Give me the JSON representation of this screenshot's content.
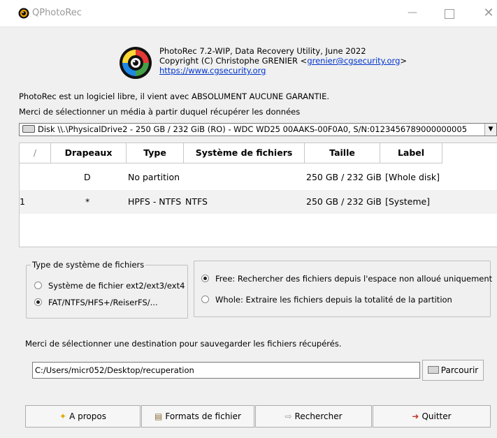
{
  "window": {
    "title": "QPhotoRec"
  },
  "about": {
    "line1": "PhotoRec 7.2-WIP, Data Recovery Utility, June 2022",
    "line2_prefix": "Copyright (C) Christophe GRENIER <",
    "email": "grenier@cgsecurity.org",
    "line2_suffix": ">",
    "website": "https://www.cgsecurity.org"
  },
  "notice": {
    "license": "PhotoRec est un logiciel libre, il vient avec ABSOLUMENT AUCUNE GARANTIE.",
    "select_media": "Merci de sélectionner un média à partir duquel récupérer les données"
  },
  "disk_select": {
    "value": "Disk \\\\.\\PhysicalDrive2 - 250 GB / 232 GiB (RO) - WDC WD25 00AAKS-00F0A0, S/N:0123456789000000005"
  },
  "partition_table": {
    "columns": [
      "/",
      "Drapeaux",
      "Type",
      "Système de fichiers",
      "Taille",
      "Label"
    ],
    "rows": [
      {
        "num": "",
        "flag": "D",
        "type": "No partition",
        "fs": "",
        "size": "250 GB / 232 GiB",
        "label": "[Whole disk]"
      },
      {
        "num": "1",
        "flag": "*",
        "type": "HPFS - NTFS",
        "fs": "NTFS",
        "size": "250 GB / 232 GiB",
        "label": "[Systeme]"
      }
    ]
  },
  "fs_type": {
    "legend": "Type de système de fichiers",
    "options": [
      "Système de fichier ext2/ext3/ext4",
      "FAT/NTFS/HFS+/ReiserFS/..."
    ],
    "selected": 1
  },
  "scan_mode": {
    "options": [
      "Free: Rechercher des fichiers depuis l'espace non alloué uniquement",
      "Whole: Extraire les fichiers depuis la totalité de la partition"
    ],
    "selected": 0
  },
  "destination": {
    "prompt": "Merci de sélectionner une destination pour sauvegarder les fichiers récupérés.",
    "path": "C:/Users/micr052/Desktop/recuperation",
    "browse_label": "Parcourir"
  },
  "buttons": {
    "about": "A propos",
    "formats": "Formats de fichier",
    "search": "Rechercher",
    "quit": "Quitter"
  },
  "colors": {
    "link": "#0033cc",
    "row_alt": "#f2f2f2"
  }
}
